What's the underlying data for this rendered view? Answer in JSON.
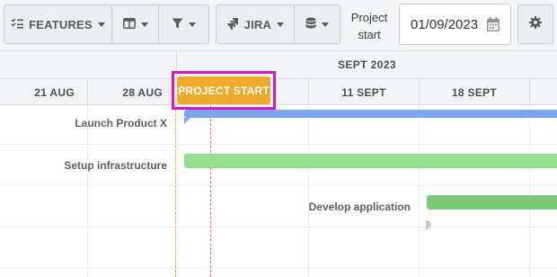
{
  "toolbar": {
    "features_label": "FEATURES",
    "jira_label": "JIRA",
    "project_start_label": "Project start",
    "project_start_line1": "Project",
    "project_start_line2": "start",
    "date_value": "01/09/2023",
    "icons": [
      "list-checks-icon",
      "columns-icon",
      "filter-icon",
      "jira-icon",
      "database-icon",
      "calendar-icon",
      "gear-icon"
    ]
  },
  "timeline": {
    "month": "SEPT 2023",
    "weeks": [
      "21 AUG",
      "28 AUG",
      "11 SEPT",
      "18 SEPT"
    ],
    "marker": "PROJECT START"
  },
  "tasks": [
    {
      "label": "Launch Product X",
      "color": "#7fa5f1"
    },
    {
      "label": "Setup infrastructure",
      "color": "#95dd8f"
    },
    {
      "label": "Develop application",
      "color": "#7fca7a"
    }
  ],
  "colors": {
    "marker_bg": "#f0a92f",
    "highlight": "#d417c6"
  }
}
